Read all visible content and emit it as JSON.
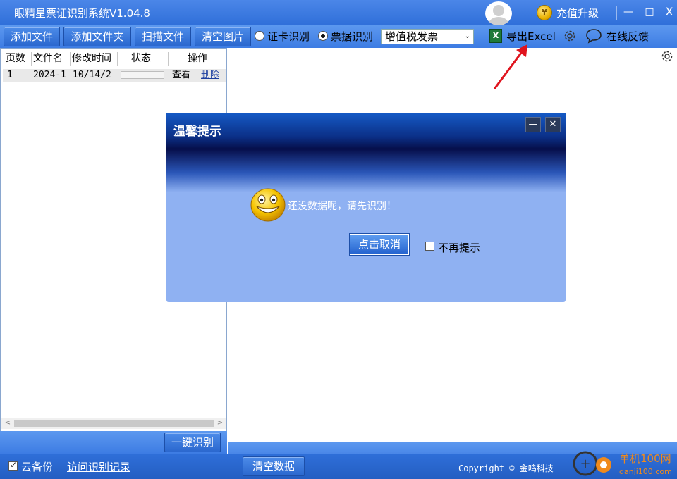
{
  "window": {
    "title": "眼精星票证识别系统V1.04.8",
    "recharge_label": "充值升级",
    "coin_symbol": "¥",
    "minimize_symbol": "—",
    "restore_symbol": "□",
    "close_symbol": "X"
  },
  "toolbar": {
    "add_file": "添加文件",
    "add_folder": "添加文件夹",
    "scan_file": "扫描文件",
    "clear_images": "清空图片",
    "radio_card": "证卡识别",
    "radio_bill": "票据识别",
    "selected_radio": "票据识别",
    "invoice_type": "增值税发票",
    "export_excel": "导出Excel",
    "excel_icon_letter": "X",
    "feedback": "在线反馈"
  },
  "file_table": {
    "headers": [
      "页数",
      "文件名",
      "修改时间",
      "状态",
      "操作"
    ],
    "rows": [
      {
        "page": "1",
        "file_name": "2024-1",
        "modified": "10/14/2",
        "status_progress": 0,
        "view": "查看",
        "delete": "删除"
      }
    ]
  },
  "left_panel": {
    "recognize_all": "一键识别",
    "scroll_left": "<",
    "scroll_right": ">"
  },
  "dialog": {
    "title": "温馨提示",
    "message": "还没数据呢，请先识别！",
    "ok_button": "点击取消",
    "dont_show_again": "不再提示",
    "dont_show_checked": false,
    "min_symbol": "—",
    "close_symbol": "✕"
  },
  "statusbar": {
    "cloud_backup": "云备份",
    "cloud_backup_checked": true,
    "visit_records": "访问识别记录",
    "clear_data": "清空数据",
    "copyright": "Copyright © 金鸣科技"
  },
  "watermark": {
    "site_name": "单机100网",
    "site_url": "danji100.com"
  },
  "colors": {
    "accent_blue": "#3d7ce3",
    "title_blue": "#2f6fd9",
    "dialog_bg": "#8fb1f2",
    "arrow_red": "#e0141e",
    "watermark_orange": "#f08a1c"
  }
}
